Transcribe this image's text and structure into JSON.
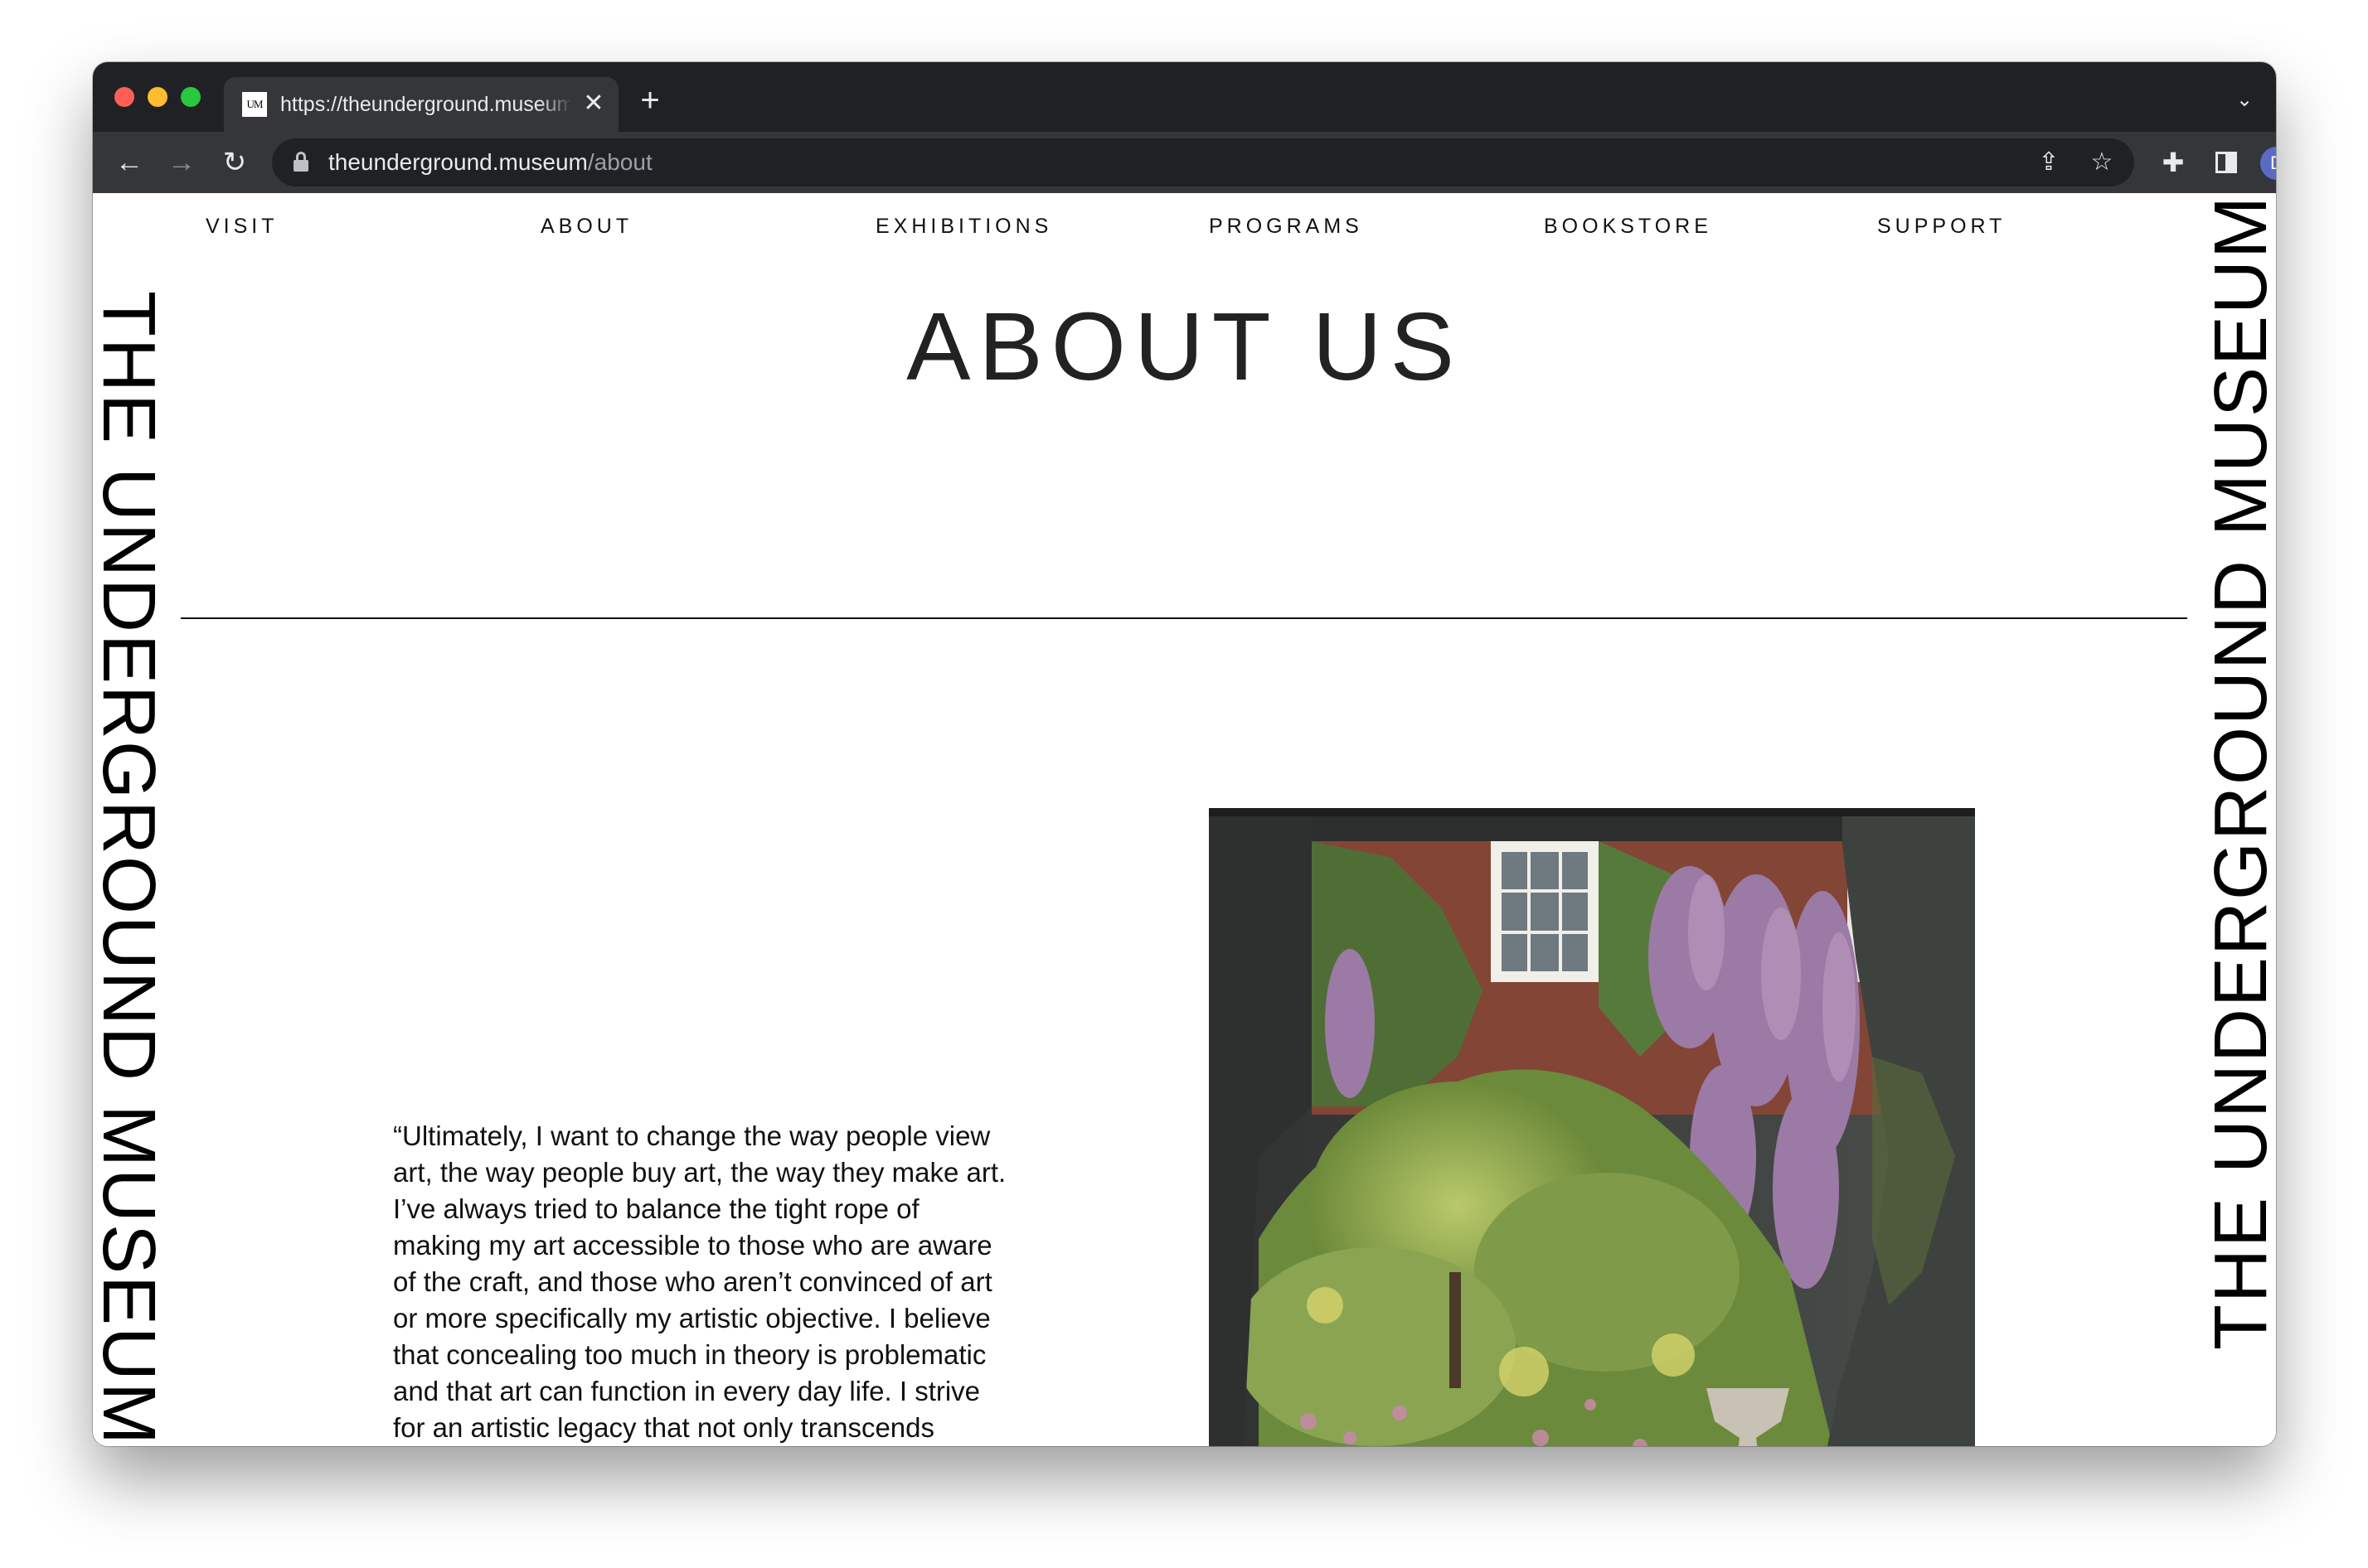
{
  "browser": {
    "tab_title": "https://theunderground.museum/about",
    "tab_favicon_text": "UM",
    "url_host": "theunderground.museum",
    "url_path": "/about",
    "profile_initial": "D"
  },
  "nav": {
    "items": [
      "VISIT",
      "ABOUT",
      "EXHIBITIONS",
      "PROGRAMS",
      "BOOKSTORE",
      "SUPPORT"
    ]
  },
  "side_wordmark": "THE UNDERGROUND MUSEUM",
  "page": {
    "title": "ABOUT US",
    "quote": "“Ultimately, I want to change the way people view art, the way people buy art, the way they make art. I’ve always tried to balance the tight rope of making my art accessible to those who are aware of the craft, and those who aren’t convinced of art or more specifically my artistic objective. I believe that concealing too much in theory is problematic and that art can function in every day life. I strive for an artistic legacy that not only transcends blackness but confluences and impacts all cultures.”"
  },
  "colors": {
    "chrome_dark": "#202124",
    "chrome_toolbar": "#35363a",
    "page_bg": "#ffffff",
    "text": "#111111"
  }
}
